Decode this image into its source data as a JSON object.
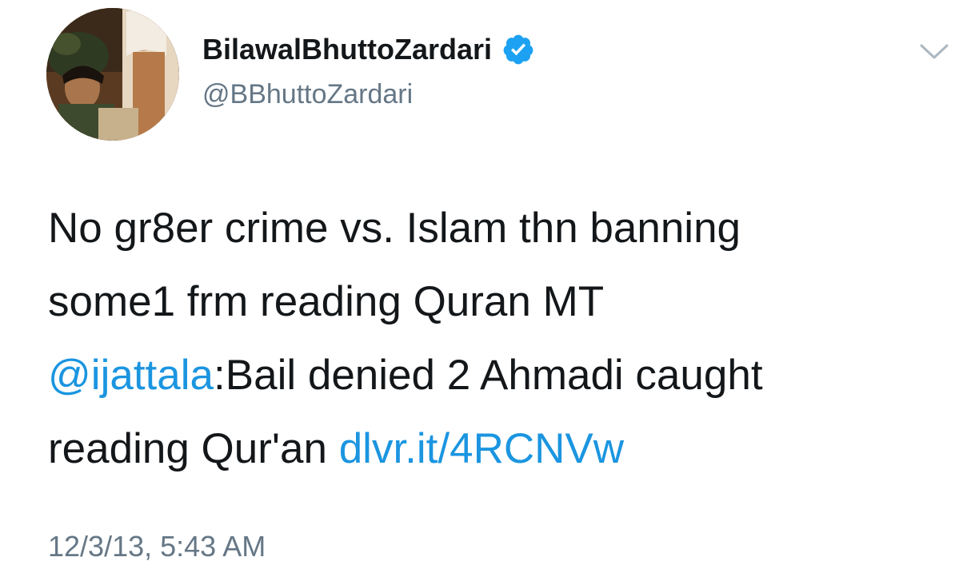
{
  "author": {
    "display_name": "BilawalBhuttoZardari",
    "handle": "@BBhuttoZardari",
    "verified": true,
    "avatar_icon": "profile-photo"
  },
  "menu": {
    "icon": "chevron-down-icon"
  },
  "tweet": {
    "line1": "No gr8er crime vs. Islam thn banning",
    "line2": "some1 frm reading Quran MT",
    "mention": "@ijattala",
    "line3_rest": ":Bail denied 2 Ahmadi caught",
    "line4_start": "reading Qur'an ",
    "link": "dlvr.it/4RCNVw"
  },
  "timestamp": "12/3/13, 5:43 AM",
  "colors": {
    "link": "#1b95e0",
    "verified": "#1da1f2",
    "secondary_text": "#657786",
    "primary_text": "#14171a"
  }
}
